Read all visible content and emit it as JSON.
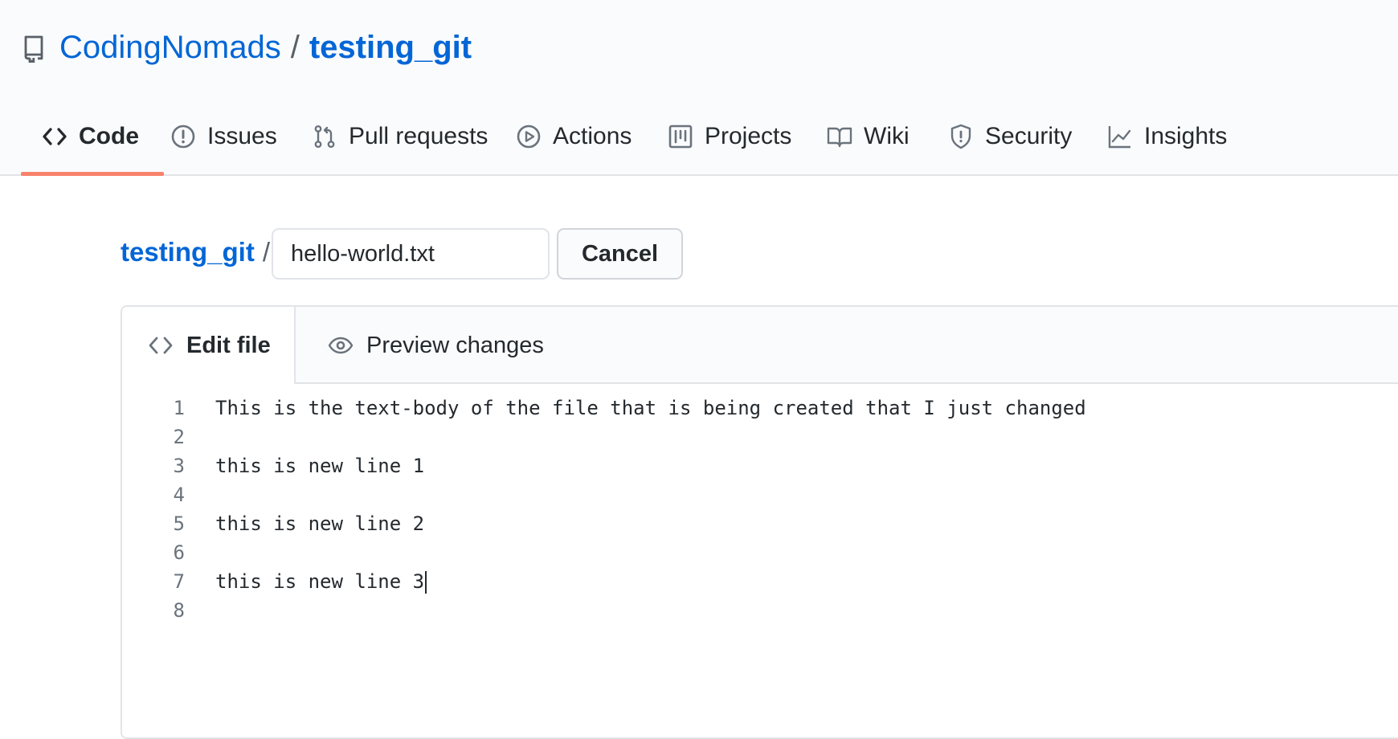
{
  "repo": {
    "owner": "CodingNomads",
    "separator": "/",
    "name": "testing_git"
  },
  "nav": {
    "items": [
      {
        "label": "Code",
        "icon": "code-icon",
        "active": true
      },
      {
        "label": "Issues",
        "icon": "issue-opened-icon"
      },
      {
        "label": "Pull requests",
        "icon": "git-pull-request-icon"
      },
      {
        "label": "Actions",
        "icon": "play-icon"
      },
      {
        "label": "Projects",
        "icon": "project-icon"
      },
      {
        "label": "Wiki",
        "icon": "book-icon"
      },
      {
        "label": "Security",
        "icon": "shield-icon"
      },
      {
        "label": "Insights",
        "icon": "graph-icon"
      }
    ]
  },
  "breadcrumb": {
    "repo_link": "testing_git",
    "separator": "/"
  },
  "filename": {
    "value": "hello-world.txt"
  },
  "actions": {
    "cancel_label": "Cancel"
  },
  "editor": {
    "tabs": [
      {
        "label": "Edit file",
        "icon": "code-icon",
        "active": true
      },
      {
        "label": "Preview changes",
        "icon": "eye-icon"
      }
    ],
    "lines": [
      {
        "number": "1",
        "text": "This is the text-body of the file that is being created that I just changed"
      },
      {
        "number": "2",
        "text": ""
      },
      {
        "number": "3",
        "text": "this is new line 1"
      },
      {
        "number": "4",
        "text": ""
      },
      {
        "number": "5",
        "text": "this is new line 2"
      },
      {
        "number": "6",
        "text": ""
      },
      {
        "number": "7",
        "text": "this is new line 3"
      },
      {
        "number": "8",
        "text": ""
      }
    ]
  },
  "colors": {
    "link": "#0366d6",
    "active_underline": "#f9826c",
    "text": "#24292e",
    "muted": "#586069"
  }
}
